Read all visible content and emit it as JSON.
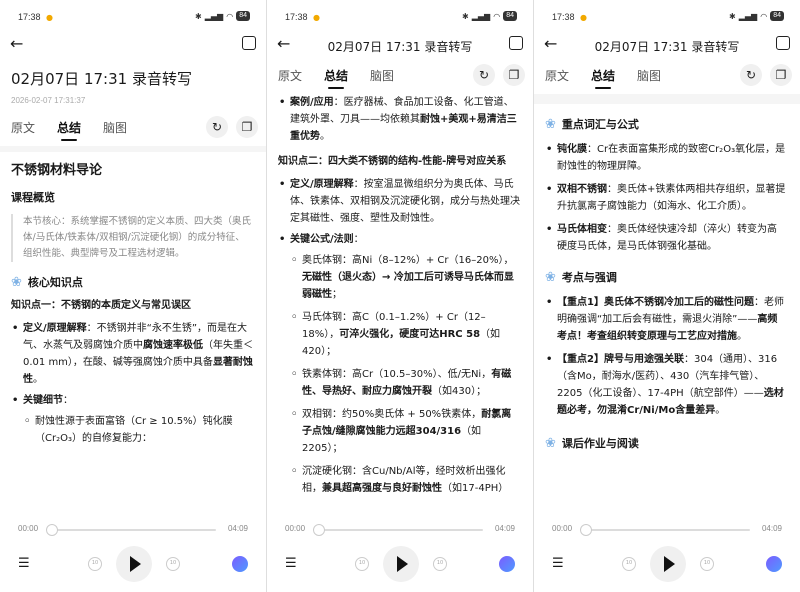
{
  "status": {
    "time": "17:38",
    "battery": "84"
  },
  "header": {
    "page_title": "02月07日 17:31 录音转写",
    "big_title": "02月07日  17:31 录音转写",
    "date": "2026-02-07 17:31:37"
  },
  "tabs": [
    "原文",
    "总结",
    "脑图"
  ],
  "panel1": {
    "doc_title": "不锈钢材料导论",
    "overview_heading": "课程概览",
    "overview_text": "本节核心：系统掌握不锈钢的定义本质、四大类（奥氏体/马氏体/铁素体/双相钢/沉淀硬化钢）的成分特征、组织性能、典型牌号及工程选材逻辑。",
    "knowledge_heading": "核心知识点",
    "kp1_title": "知识点一：不锈钢的本质定义与常见误区",
    "def_label": "定义/原理解释",
    "def_a": "：不锈钢并非“永不生锈”，而是在大气、水蒸气及弱腐蚀介质中",
    "def_b": "腐蚀速率极低",
    "def_c": "（年失重＜0.01 mm），在酸、碱等强腐蚀介质中具备",
    "def_d": "显著耐蚀性",
    "def_e": "。",
    "detail_label": "关键细节",
    "detail_colon": "：",
    "detail_item": "耐蚀性源于表面富铬（Cr ≥ 10.5%）钝化膜（Cr₂O₃）的自修复能力："
  },
  "panel2": {
    "case_label": "案例/应用",
    "case_a": "：医疗器械、食品加工设备、化工管道、建筑外罩、刀具——均依赖其",
    "case_b": "耐蚀+美观+易清洁三重优势",
    "case_c": "。",
    "kp2_title": "知识点二：四大类不锈钢的结构-性能-牌号对应关系",
    "def2_label": "定义/原理解释",
    "def2_text": "：按室温显微组织分为奥氏体、马氏体、铁素体、双相钢及沉淀硬化钢，成分与热处理决定其磁性、强度、塑性及耐蚀性。",
    "formula_label": "关键公式/法则",
    "formula_colon": "：",
    "items": [
      {
        "a": "奥氏体钢：高Ni（8–12%）+ Cr（16–20%），",
        "b": "无磁性（退火态）→ 冷加工后可诱导马氏体而显弱磁性",
        "c": "；"
      },
      {
        "a": "马氏体钢：高C（0.1–1.2%）+ Cr（12–18%），",
        "b": "可淬火强化，硬度可达HRC 58",
        "c": "（如420）；"
      },
      {
        "a": "铁素体钢：高Cr（10.5–30%）、低/无Ni，",
        "b": "有磁性、导热好、耐应力腐蚀开裂",
        "c": "（如430）；"
      },
      {
        "a": "双相钢：约50%奥氏体 + 50%铁素体，",
        "b": "耐氯离子点蚀/缝隙腐蚀能力远超304/316",
        "c": "（如2205）；"
      },
      {
        "a": "沉淀硬化钢：含Cu/Nb/Al等，经时效析出强化相，",
        "b": "兼具超高强度与良好耐蚀性",
        "c": "（如17-4PH）"
      }
    ]
  },
  "panel3": {
    "terms_heading": "重点词汇与公式",
    "terms": [
      {
        "t": "钝化膜",
        "d": "：Cr在表面富集形成的致密Cr₂O₃氧化层，是耐蚀性的物理屏障。"
      },
      {
        "t": "双相不锈钢",
        "d": "：奥氏体+铁素体两相共存组织，显著提升抗氯离子腐蚀能力（如海水、化工介质）。"
      },
      {
        "t": "马氏体相变",
        "d": "：奥氏体经快速冷却（淬火）转变为高硬度马氏体，是马氏体钢强化基础。"
      }
    ],
    "exam_heading": "考点与强调",
    "exam": [
      {
        "a": "【重点1】奥氏体不锈钢冷加工后的磁性问题",
        "b": "：老师明确强调“加工后会有磁性，需退火消除”——",
        "c": "高频考点！考查组织转变原理与工艺应对措施",
        "d": "。"
      },
      {
        "a": "【重点2】牌号与用途强关联",
        "b": "：304（通用）、316（含Mo，耐海水/医药）、430（汽车排气管）、2205（化工设备）、17-4PH（航空部件）——",
        "c": "选材题必考，勿混淆Cr/Ni/Mo含量差异",
        "d": "。"
      }
    ],
    "homework_heading": "课后作业与阅读"
  },
  "player": {
    "current": "00:00",
    "total": "04:09",
    "rewind": "10",
    "forward": "10"
  },
  "icons": [
    "back-arrow-icon",
    "share-icon",
    "refresh-icon",
    "copy-icon",
    "playlist-icon",
    "play-icon",
    "ai-assistant-icon",
    "flower-icon"
  ]
}
